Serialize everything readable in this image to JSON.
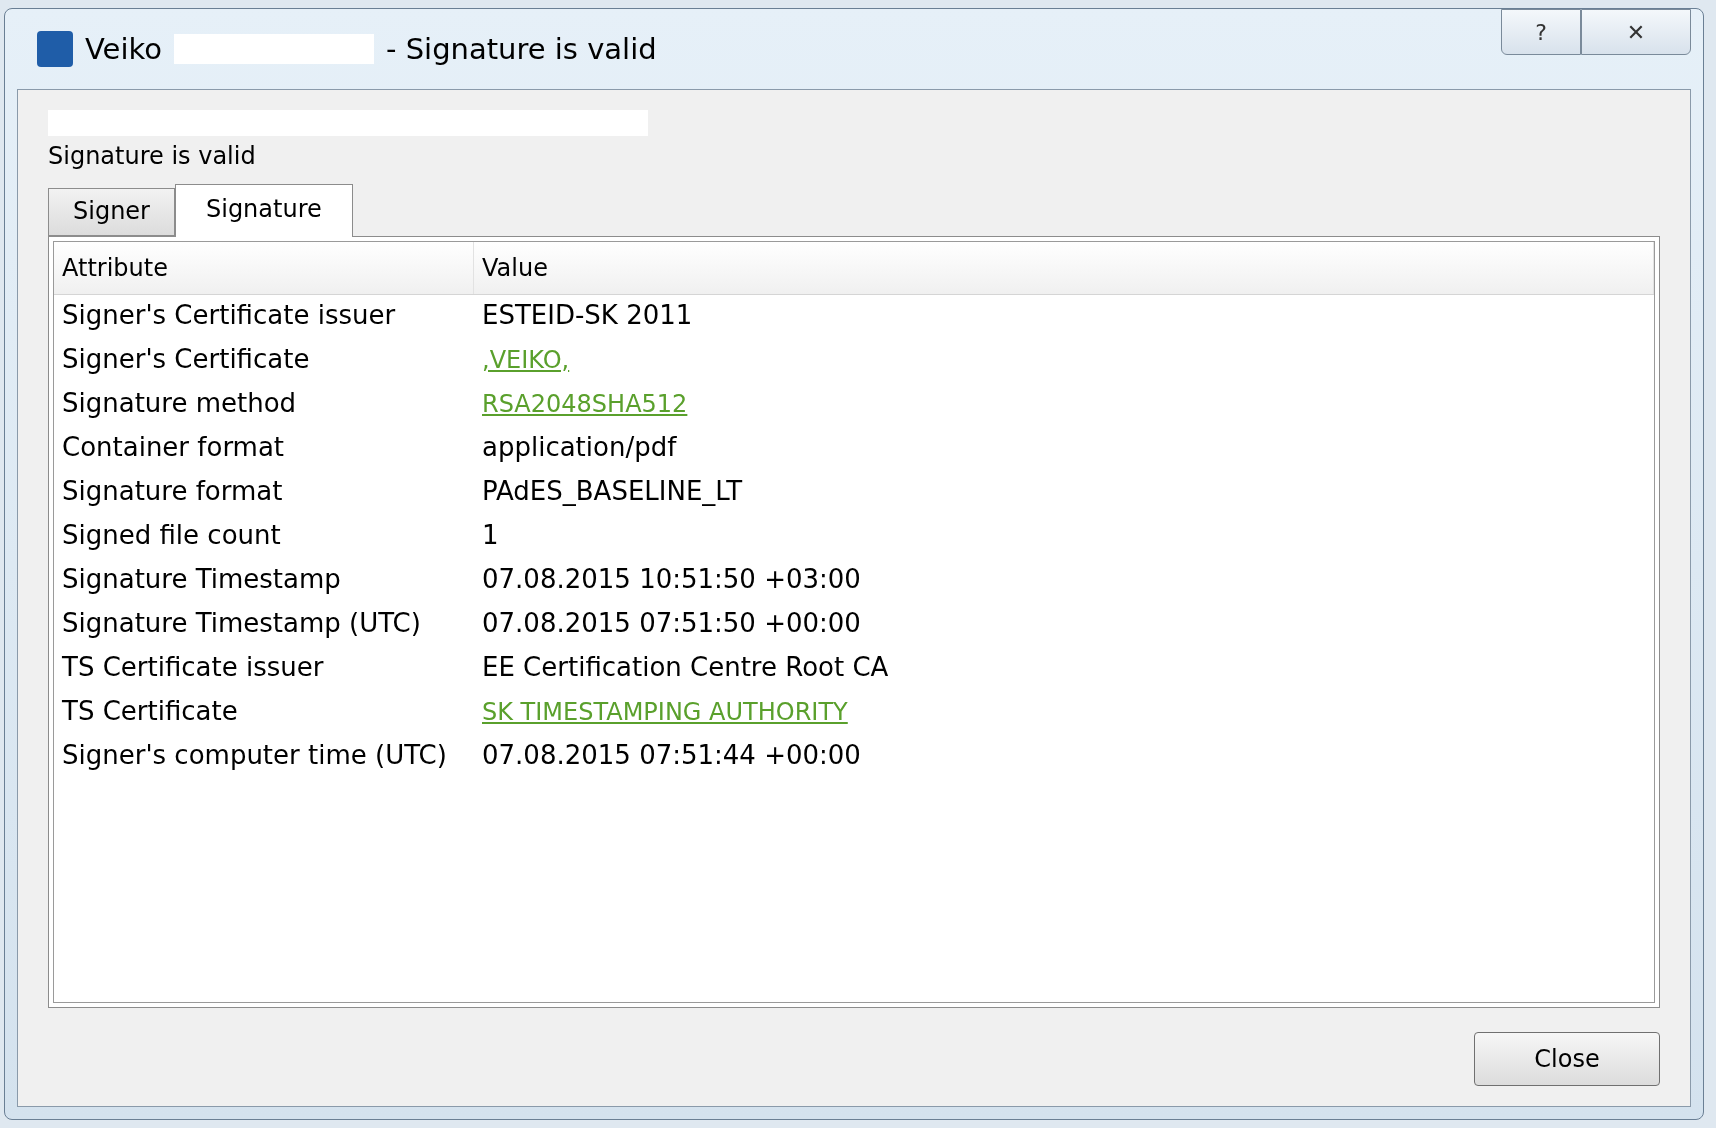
{
  "window": {
    "title_name": "Veiko",
    "title_suffix": "- Signature is valid",
    "buttons": [
      {
        "kind": "help",
        "label": "?"
      },
      {
        "kind": "close",
        "label": "✕"
      }
    ]
  },
  "status_text": "Signature is valid",
  "tabs": [
    {
      "label": "Signer",
      "selected": false
    },
    {
      "label": "Signature",
      "selected": true
    }
  ],
  "table": {
    "columns": [
      "Attribute",
      "Value"
    ],
    "rows": [
      {
        "attribute": "Signer's Certificate issuer",
        "value": "ESTEID-SK 2011",
        "kind": "text"
      },
      {
        "attribute": "Signer's Certificate",
        "value": ",VEIKO,",
        "kind": "link"
      },
      {
        "attribute": "Signature method",
        "value": "RSA2048SHA512",
        "kind": "link"
      },
      {
        "attribute": "Container format",
        "value": "application/pdf",
        "kind": "text"
      },
      {
        "attribute": "Signature format",
        "value": "PAdES_BASELINE_LT",
        "kind": "text"
      },
      {
        "attribute": "Signed file count",
        "value": "1",
        "kind": "text"
      },
      {
        "attribute": "Signature Timestamp",
        "value": "07.08.2015 10:51:50 +03:00",
        "kind": "text"
      },
      {
        "attribute": "Signature Timestamp (UTC)",
        "value": "07.08.2015 07:51:50 +00:00",
        "kind": "text"
      },
      {
        "attribute": "TS Certificate issuer",
        "value": "EE Certification Centre Root CA",
        "kind": "text"
      },
      {
        "attribute": "TS Certificate",
        "value": "SK TIMESTAMPING AUTHORITY",
        "kind": "link"
      },
      {
        "attribute": "Signer's computer time (UTC)",
        "value": "07.08.2015 07:51:44 +00:00",
        "kind": "text"
      }
    ]
  },
  "footer_button": "Close"
}
